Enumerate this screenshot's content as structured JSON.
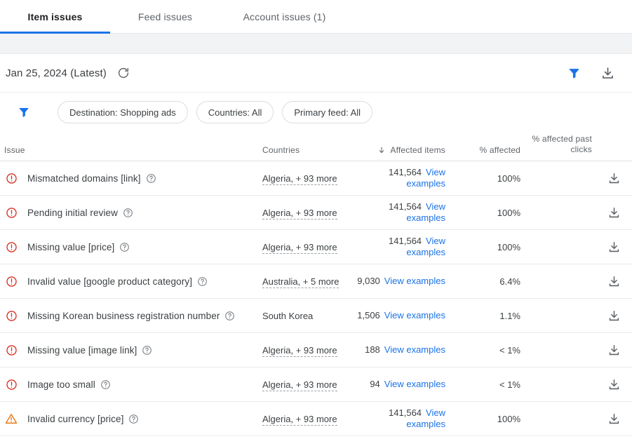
{
  "tabs": [
    {
      "label": "Item issues",
      "active": true
    },
    {
      "label": "Feed issues",
      "active": false
    },
    {
      "label": "Account issues (1)",
      "active": false
    }
  ],
  "toolbar": {
    "date_label": "Jan 25, 2024 (Latest)",
    "refresh_icon": "refresh-icon",
    "filter_icon": "filter-funnel-icon",
    "download_icon": "download-icon"
  },
  "filters": {
    "funnel_icon": "filter-funnel-icon",
    "chips": [
      {
        "label": "Destination: Shopping ads"
      },
      {
        "label": "Countries: All"
      },
      {
        "label": "Primary feed: All"
      }
    ]
  },
  "table": {
    "headers": {
      "issue": "Issue",
      "countries": "Countries",
      "affected_items": "Affected items",
      "affected_items_sort": "descending",
      "pct_affected": "% affected",
      "pct_affected_past_clicks": "% affected past clicks"
    },
    "rows": [
      {
        "severity": "error",
        "issue": "Mismatched domains [link]",
        "countries": "Algeria, + 93 more",
        "countries_link": true,
        "affected_items": "141,564",
        "view_examples": "View examples",
        "pct_affected": "100%",
        "pct_affected_past_clicks": ""
      },
      {
        "severity": "error",
        "issue": "Pending initial review",
        "countries": "Algeria, + 93 more",
        "countries_link": true,
        "affected_items": "141,564",
        "view_examples": "View examples",
        "pct_affected": "100%",
        "pct_affected_past_clicks": ""
      },
      {
        "severity": "error",
        "issue": "Missing value [price]",
        "countries": "Algeria, + 93 more",
        "countries_link": true,
        "affected_items": "141,564",
        "view_examples": "View examples",
        "pct_affected": "100%",
        "pct_affected_past_clicks": ""
      },
      {
        "severity": "error",
        "issue": "Invalid value [google product category]",
        "countries": "Australia, + 5 more",
        "countries_link": true,
        "affected_items": "9,030",
        "view_examples": "View examples",
        "pct_affected": "6.4%",
        "pct_affected_past_clicks": ""
      },
      {
        "severity": "error",
        "issue": "Missing Korean business registration number",
        "countries": "South Korea",
        "countries_link": false,
        "affected_items": "1,506",
        "view_examples": "View examples",
        "pct_affected": "1.1%",
        "pct_affected_past_clicks": ""
      },
      {
        "severity": "error",
        "issue": "Missing value [image link]",
        "countries": "Algeria, + 93 more",
        "countries_link": true,
        "affected_items": "188",
        "view_examples": "View examples",
        "pct_affected": "< 1%",
        "pct_affected_past_clicks": ""
      },
      {
        "severity": "error",
        "issue": "Image too small",
        "countries": "Algeria, + 93 more",
        "countries_link": true,
        "affected_items": "94",
        "view_examples": "View examples",
        "pct_affected": "< 1%",
        "pct_affected_past_clicks": ""
      },
      {
        "severity": "warning",
        "issue": "Invalid currency [price]",
        "countries": "Algeria, + 93 more",
        "countries_link": true,
        "affected_items": "141,564",
        "view_examples": "View examples",
        "pct_affected": "100%",
        "pct_affected_past_clicks": ""
      }
    ]
  },
  "colors": {
    "accent_blue": "#1a73e8",
    "error_red": "#d93025",
    "warning_orange": "#e8710a",
    "text_primary": "#3c4043",
    "text_secondary": "#5f6368",
    "border": "#e8eaed",
    "band_gray": "#f1f3f4"
  }
}
